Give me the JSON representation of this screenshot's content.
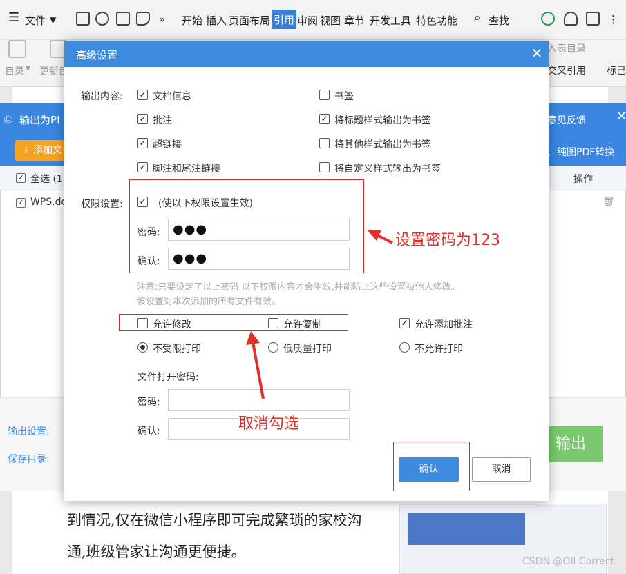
{
  "app": {
    "menu": {
      "file_label": "文件",
      "more": "»"
    },
    "tabs": [
      "开始",
      "插入",
      "页面布局",
      "引用",
      "审阅",
      "视图",
      "章节",
      "开发工具",
      "特色功能"
    ],
    "active_tab": "引用",
    "search_label": "查找",
    "ribbon": {
      "toc_label": "目录",
      "update_label": "更新目",
      "insert_table_toc": "入表目录",
      "cross_ref": "交叉引用",
      "mark_label": "标己"
    }
  },
  "pdf_window": {
    "title": "输出为PI",
    "feedback": "意见反馈",
    "add_file": "+ 添加文",
    "convert": "、纯图PDF转换",
    "table": {
      "select_all": "全选 (1",
      "ops_header": "操作",
      "file_row": "WPS.do"
    },
    "output_settings_label": "输出设置:",
    "save_dir_label": "保存目录:",
    "output_button": "输出"
  },
  "dialog": {
    "title": "高级设置",
    "close": "✕",
    "output_content_label": "输出内容:",
    "output_options": [
      {
        "label": "文档信息",
        "checked": true
      },
      {
        "label": "书签",
        "checked": false
      },
      {
        "label": "批注",
        "checked": true
      },
      {
        "label": "将标题样式输出为书签",
        "checked": true
      },
      {
        "label": "超链接",
        "checked": true
      },
      {
        "label": "将其他样式输出为书签",
        "checked": false
      },
      {
        "label": "脚注和尾注链接",
        "checked": true
      },
      {
        "label": "将自定义样式输出为书签",
        "checked": false
      }
    ],
    "permission_label": "权限设置:",
    "permission_enable": "(使以下权限设置生效)",
    "password_label": "密码:",
    "confirm_label": "确认:",
    "password_value": "●●●",
    "confirm_value": "●●●",
    "note_line1": "注意:只要设定了以上密码,以下权限内容才会生效,并能防止这些设置被他人修改。",
    "note_line2": "该设置对本次添加的所有文件有效。",
    "permissions": {
      "allow_modify": "允许修改",
      "allow_copy": "允许复制",
      "allow_annotate": "允许添加批注",
      "allow_modify_checked": false,
      "allow_copy_checked": false,
      "allow_annotate_checked": true
    },
    "print": {
      "unlimited": "不受限打印",
      "low_quality": "低质量打印",
      "no_print": "不允许打印",
      "selected": "unlimited"
    },
    "open_password_label": "文件打开密码:",
    "open_password_label2": "密码:",
    "open_confirm_label": "确认:",
    "ok_button": "确认",
    "cancel_button": "取消"
  },
  "annotations": {
    "set_password": "设置密码为123",
    "uncheck": "取消勾选",
    "color": "#e0302a"
  },
  "document": {
    "line1": "到情况,仅在微信小程序即可完成繁琐的家校沟",
    "line2": "通,班级管家让沟通更便捷。"
  },
  "watermark": "CSDN @OIl Correct"
}
